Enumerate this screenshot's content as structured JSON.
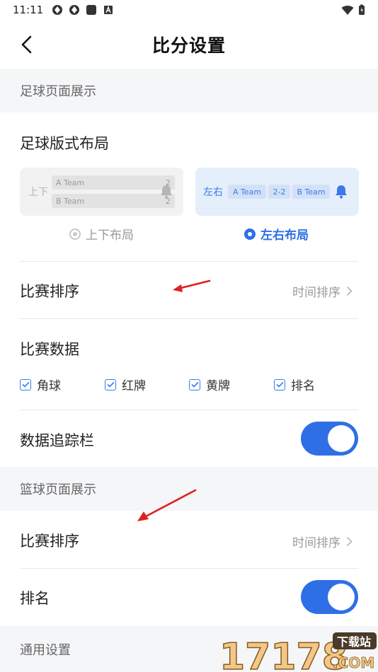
{
  "status_bar": {
    "time": "11:11"
  },
  "title_bar": {
    "title": "比分设置"
  },
  "football": {
    "section_title": "足球页面展示",
    "layout_label": "足球版式布局",
    "layout_tb": {
      "side_label": "上下",
      "team_a": "A Team",
      "score_a": "2",
      "team_b": "B Team",
      "score_b": "2",
      "option_label": "上下布局",
      "selected": false
    },
    "layout_lr": {
      "side_label": "左右",
      "team_a": "A Team",
      "score": "2-2",
      "team_b": "B Team",
      "option_label": "左右布局",
      "selected": true
    },
    "sort_label": "比赛排序",
    "sort_value": "时间排序",
    "data_label": "比赛数据",
    "data_options": [
      {
        "label": "角球",
        "checked": true
      },
      {
        "label": "红牌",
        "checked": true
      },
      {
        "label": "黄牌",
        "checked": true
      },
      {
        "label": "排名",
        "checked": true
      }
    ],
    "tracker_label": "数据追踪栏",
    "tracker_on": true
  },
  "basketball": {
    "section_title": "篮球页面展示",
    "sort_label": "比赛排序",
    "sort_value": "时间排序",
    "rank_label": "排名",
    "rank_on": true
  },
  "general": {
    "section_title": "通用设置"
  },
  "watermark": {
    "text_main": "17178",
    "text_sub": ".COM",
    "text_badge": "下载站"
  },
  "colors": {
    "accent": "#2f6fe6",
    "annotation": "#e02020"
  }
}
